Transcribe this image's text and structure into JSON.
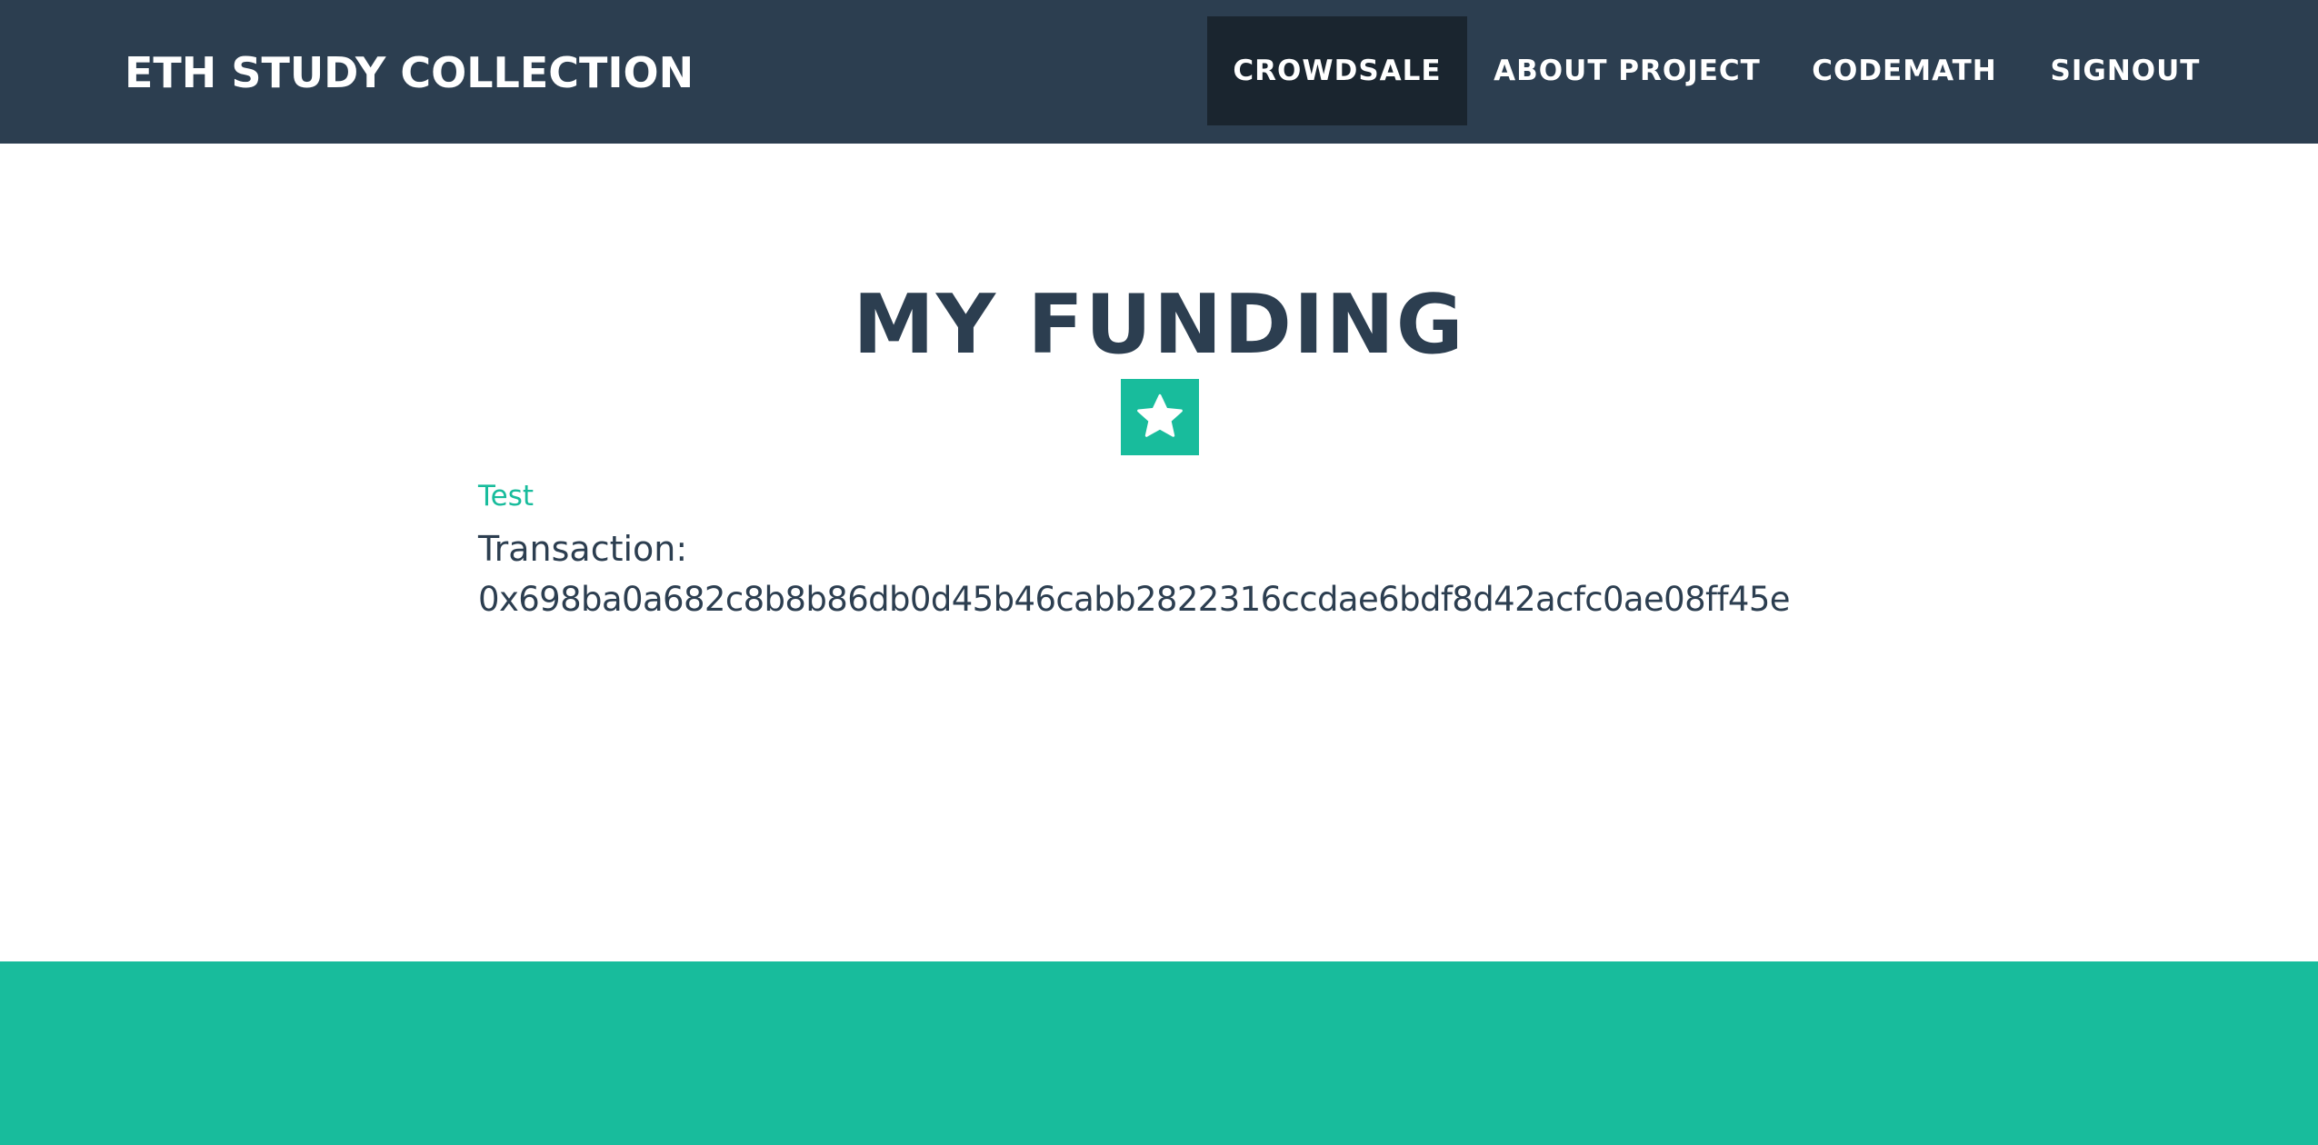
{
  "navbar": {
    "brand": "ETH STUDY COLLECTION",
    "items": [
      {
        "label": "CROWDSALE",
        "active": true
      },
      {
        "label": "ABOUT PROJECT",
        "active": false
      },
      {
        "label": "CODEMATH",
        "active": false
      },
      {
        "label": "SIGNOUT",
        "active": false
      }
    ]
  },
  "main": {
    "title": "MY FUNDING",
    "divider_icon": "star-icon",
    "entry": {
      "name": "Test",
      "transaction_label": "Transaction:",
      "transaction_hash": "0x698ba0a682c8b8b86db0d45b46cabb2822316ccdae6bdf8d42acfc0ae08ff45e"
    }
  },
  "colors": {
    "navbar_bg": "#2c3e50",
    "nav_active_bg": "#1a252f",
    "accent": "#18bc9c",
    "text_dark": "#2c3e50"
  }
}
